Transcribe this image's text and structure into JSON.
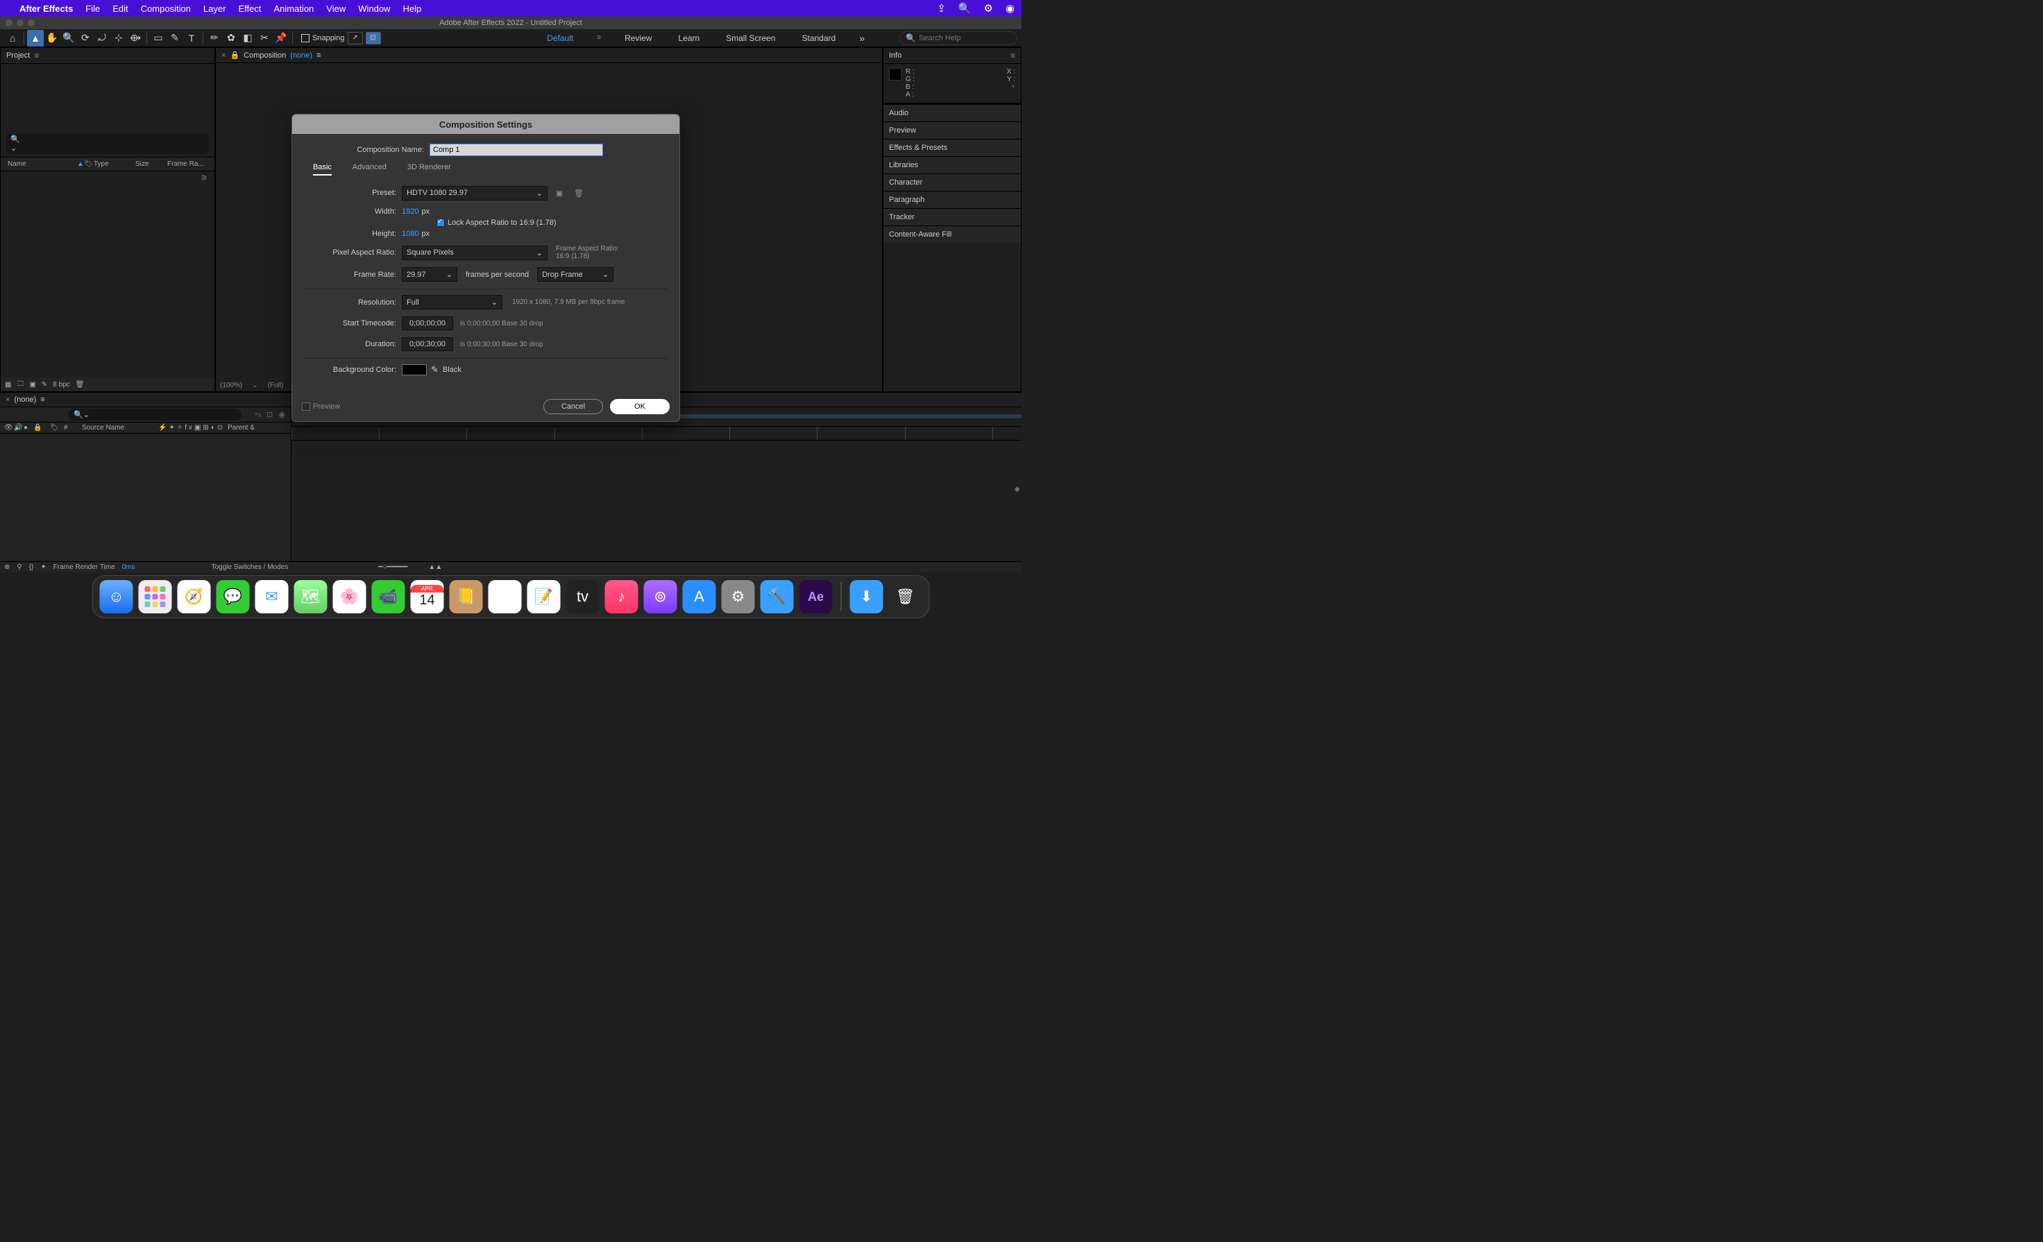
{
  "menubar": {
    "app": "After Effects",
    "items": [
      "File",
      "Edit",
      "Composition",
      "Layer",
      "Effect",
      "Animation",
      "View",
      "Window",
      "Help"
    ]
  },
  "window": {
    "title": "Adobe After Effects 2022 - Untitled Project"
  },
  "toolbar": {
    "snapping": "Snapping",
    "workspaces": [
      "Default",
      "Review",
      "Learn",
      "Small Screen",
      "Standard"
    ],
    "search_placeholder": "Search Help"
  },
  "project": {
    "tab": "Project",
    "cols": {
      "name": "Name",
      "type": "Type",
      "size": "Size",
      "fr": "Frame Ra..."
    },
    "bpc": "8 bpc"
  },
  "composition": {
    "tab": "Composition",
    "none": "(none)",
    "zoom": "(100%)",
    "full": "(Full)"
  },
  "info": {
    "tab": "Info",
    "r": "R :",
    "g": "G :",
    "b": "B :",
    "a": "A :",
    "x": "X :",
    "y": "Y :"
  },
  "side_panels": [
    "Audio",
    "Preview",
    "Effects & Presets",
    "Libraries",
    "Character",
    "Paragraph",
    "Tracker",
    "Content-Aware Fill"
  ],
  "timeline": {
    "none": "(none)",
    "col_num": "#",
    "col_source": "Source Name",
    "col_parent": "Parent &",
    "frt_label": "Frame Render Time",
    "frt_val": "0ms",
    "toggle": "Toggle Switches / Modes"
  },
  "dialog": {
    "title": "Composition Settings",
    "name_label": "Composition Name:",
    "name_value": "Comp 1",
    "tabs": {
      "basic": "Basic",
      "advanced": "Advanced",
      "renderer": "3D Renderer"
    },
    "preset_label": "Preset:",
    "preset_value": "HDTV 1080 29.97",
    "width_label": "Width:",
    "width_value": "1920",
    "px": "px",
    "height_label": "Height:",
    "height_value": "1080",
    "lock": "Lock Aspect Ratio to 16:9 (1.78)",
    "par_label": "Pixel Aspect Ratio:",
    "par_value": "Square Pixels",
    "far_label": "Frame Aspect Ratio:",
    "far_value": "16:9 (1.78)",
    "fr_label": "Frame Rate:",
    "fr_value": "29.97",
    "fps": "frames per second",
    "drop": "Drop Frame",
    "res_label": "Resolution:",
    "res_value": "Full",
    "res_info": "1920 x 1080, 7.9 MB per 8bpc frame",
    "start_label": "Start Timecode:",
    "start_value": "0;00;00;00",
    "start_info": "is 0;00;00;00  Base 30    drop",
    "dur_label": "Duration:",
    "dur_value": "0;00;30;00",
    "dur_info": "is 0;00;30;00  Base 30    drop",
    "bg_label": "Background Color:",
    "bg_name": "Black",
    "preview": "Preview",
    "cancel": "Cancel",
    "ok": "OK"
  },
  "dock": {
    "date_month": "APR",
    "date_day": "14"
  }
}
